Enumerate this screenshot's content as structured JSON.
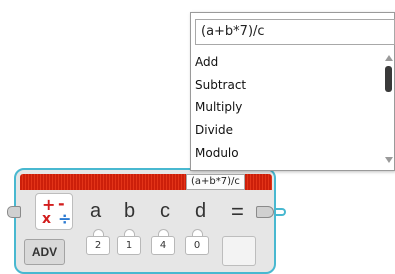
{
  "block": {
    "expression": "(a+b*7)/c",
    "inputs": [
      {
        "name": "a",
        "value": "2"
      },
      {
        "name": "b",
        "value": "1"
      },
      {
        "name": "c",
        "value": "4"
      },
      {
        "name": "d",
        "value": "0"
      }
    ],
    "equals_label": "=",
    "adv_label": "ADV",
    "operator_icon": "math-operators-icon",
    "header_color": "#cc1f0a",
    "border_color": "#48b8d0"
  },
  "popup": {
    "expression_value": "(a+b*7)/c",
    "items": [
      "Add",
      "Subtract",
      "Multiply",
      "Divide",
      "Modulo"
    ]
  }
}
